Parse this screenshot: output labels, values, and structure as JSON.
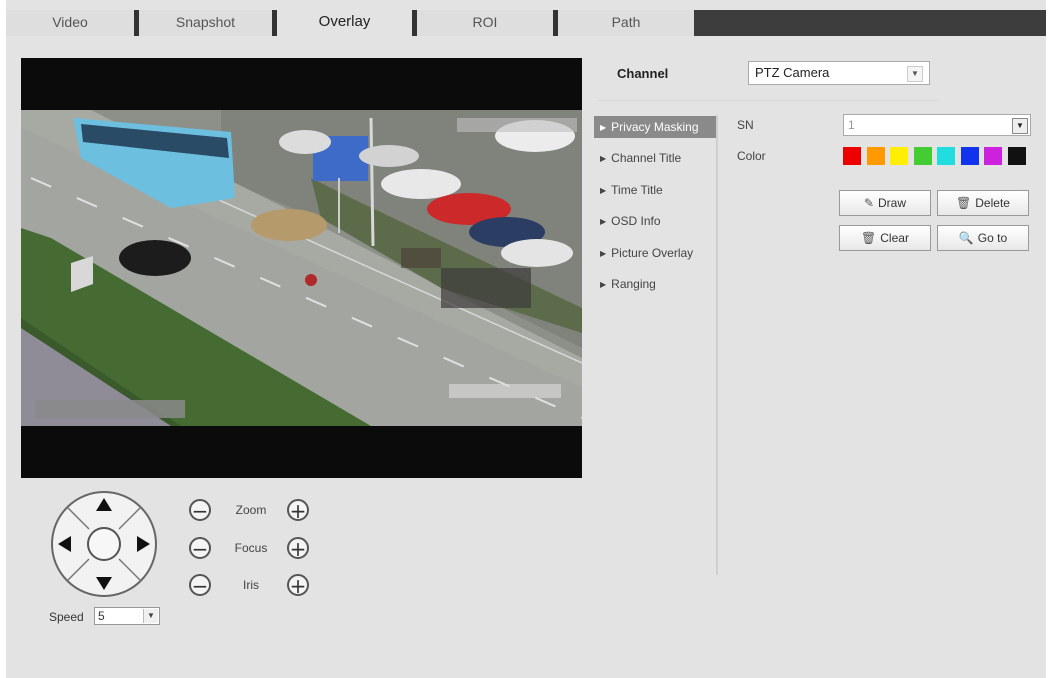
{
  "tabs": [
    {
      "label": "Video"
    },
    {
      "label": "Snapshot"
    },
    {
      "label": "Overlay"
    },
    {
      "label": "ROI"
    },
    {
      "label": "Path"
    }
  ],
  "active_tab": "Overlay",
  "channel": {
    "label": "Channel",
    "value": "PTZ Camera"
  },
  "menu": [
    {
      "label": "Privacy Masking"
    },
    {
      "label": "Channel Title"
    },
    {
      "label": "Time Title"
    },
    {
      "label": "OSD Info"
    },
    {
      "label": "Picture Overlay"
    },
    {
      "label": "Ranging"
    }
  ],
  "privacy": {
    "sn_label": "SN",
    "sn_value": "1",
    "color_label": "Color",
    "colors": [
      "#ee0000",
      "#ff9900",
      "#ffee00",
      "#44cc33",
      "#22dddd",
      "#1133ee",
      "#cc22dd",
      "#111111"
    ]
  },
  "buttons": {
    "draw": "Draw",
    "delete": "Delete",
    "clear": "Clear",
    "goto": "Go to"
  },
  "ptz": {
    "zoom": "Zoom",
    "focus": "Focus",
    "iris": "Iris",
    "speed_label": "Speed",
    "speed_value": "5"
  }
}
